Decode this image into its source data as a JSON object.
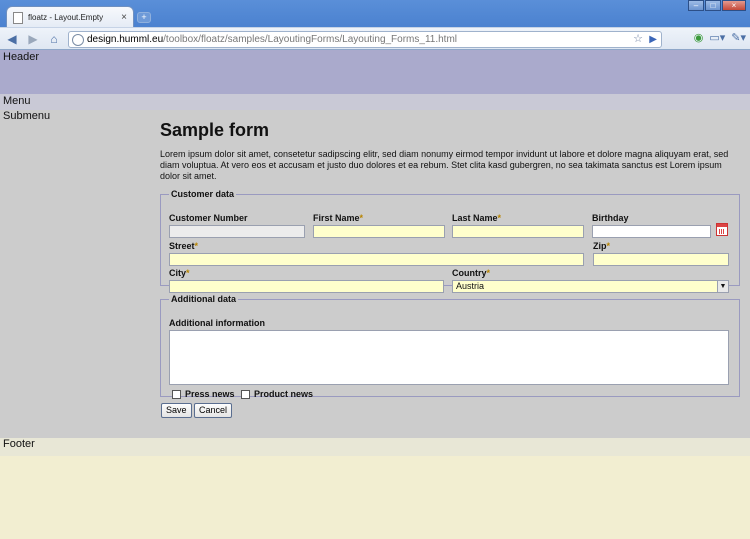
{
  "browser": {
    "tab_title": "floatz - Layout.Empty",
    "tab_close": "×",
    "new_tab": "+",
    "window_buttons": [
      "–",
      "□",
      "×"
    ],
    "nav": {
      "back": "◀",
      "forward": "▶",
      "home": "⌂",
      "reload": "↻"
    },
    "url_host": "design.humml.eu",
    "url_path": "/toolbox/floatz/samples/LayoutingForms/Layouting_Forms_11.html",
    "star": "☆",
    "go": "▶",
    "right_icons": {
      "extension": "◉",
      "page_menu": "▭▾",
      "tools_menu": "✎▾"
    }
  },
  "layout": {
    "header": "Header",
    "menu": "Menu",
    "submenu": "Submenu",
    "footer": "Footer"
  },
  "form": {
    "title": "Sample form",
    "intro": "Lorem ipsum dolor sit amet, consetetur sadipscing elitr, sed diam nonumy eirmod tempor invidunt ut labore et dolore magna aliquyam erat, sed diam voluptua. At vero eos et accusam et justo duo dolores et ea rebum. Stet clita kasd gubergren, no sea takimata sanctus est Lorem ipsum dolor sit amet.",
    "required_mark": "*",
    "customer": {
      "legend": "Customer data",
      "customer_number": "Customer Number",
      "first_name": "First Name",
      "last_name": "Last Name",
      "birthday": "Birthday",
      "street": "Street",
      "zip": "Zip",
      "city": "City",
      "country": "Country",
      "country_value": "Austria",
      "select_arrow": "▼"
    },
    "additional": {
      "legend": "Additional data",
      "info_label": "Additional information",
      "press_news": "Press news",
      "product_news": "Product news"
    },
    "buttons": {
      "save": "Save",
      "cancel": "Cancel"
    }
  },
  "colors": {
    "header_bg": "#aaaacc",
    "required_field_bg": "#ffffcc",
    "content_bg": "#cccccc",
    "footer_area_bg": "#f2eed1"
  }
}
